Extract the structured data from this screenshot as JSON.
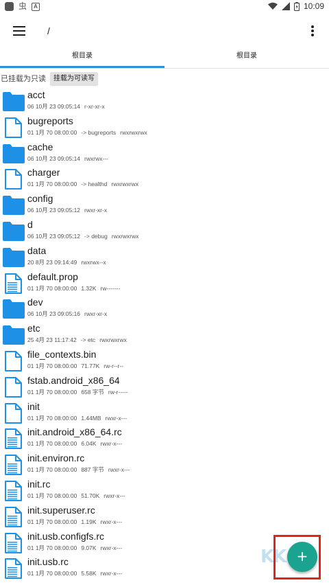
{
  "status_bar": {
    "left_glyph": "虫",
    "a_glyph": "A",
    "time": "10:09"
  },
  "toolbar": {
    "path": "/"
  },
  "tabs": [
    {
      "label": "根目录",
      "active": true
    },
    {
      "label": "根目录",
      "active": false
    }
  ],
  "mount": {
    "label": "已挂载为只读",
    "button": "挂载为可读写"
  },
  "files": [
    {
      "name": "acct",
      "type": "folder",
      "date": "06 10月 23 09:05:14",
      "extra": "",
      "perm": "r-xr-xr-x"
    },
    {
      "name": "bugreports",
      "type": "file",
      "date": "01 1月 70 08:00:00",
      "extra": "-> bugreports",
      "perm": "rwxrwxrwx"
    },
    {
      "name": "cache",
      "type": "folder",
      "date": "06 10月 23 09:05:14",
      "extra": "",
      "perm": "rwxrwx---"
    },
    {
      "name": "charger",
      "type": "file",
      "date": "01 1月 70 08:00:00",
      "extra": "-> healthd",
      "perm": "rwxrwxrwx"
    },
    {
      "name": "config",
      "type": "folder",
      "date": "06 10月 23 09:05:12",
      "extra": "",
      "perm": "rwxr-xr-x"
    },
    {
      "name": "d",
      "type": "folder",
      "date": "06 10月 23 09:05:12",
      "extra": "-> debug",
      "perm": "rwxrwxrwx"
    },
    {
      "name": "data",
      "type": "folder",
      "date": "20 8月 23 09:14:49",
      "extra": "",
      "perm": "rwxrwx--x"
    },
    {
      "name": "default.prop",
      "type": "doc",
      "date": "01 1月 70 08:00:00",
      "extra": "1.32K",
      "perm": "rw-------"
    },
    {
      "name": "dev",
      "type": "folder",
      "date": "06 10月 23 09:05:16",
      "extra": "",
      "perm": "rwxr-xr-x"
    },
    {
      "name": "etc",
      "type": "folder",
      "date": "25 4月 23 11:17:42",
      "extra": "-> etc",
      "perm": "rwxrwxrwx"
    },
    {
      "name": "file_contexts.bin",
      "type": "file",
      "date": "01 1月 70 08:00:00",
      "extra": "71.77K",
      "perm": "rw-r--r--"
    },
    {
      "name": "fstab.android_x86_64",
      "type": "file",
      "date": "01 1月 70 08:00:00",
      "extra": "658 字节",
      "perm": "rw-r-----"
    },
    {
      "name": "init",
      "type": "file",
      "date": "01 1月 70 08:00:00",
      "extra": "1.44MB",
      "perm": "rwxr-x---"
    },
    {
      "name": "init.android_x86_64.rc",
      "type": "doc",
      "date": "01 1月 70 08:00:00",
      "extra": "6.04K",
      "perm": "rwxr-x---"
    },
    {
      "name": "init.environ.rc",
      "type": "doc",
      "date": "01 1月 70 08:00:00",
      "extra": "887 字节",
      "perm": "rwxr-x---"
    },
    {
      "name": "init.rc",
      "type": "doc",
      "date": "01 1月 70 08:00:00",
      "extra": "51.70K",
      "perm": "rwxr-x---"
    },
    {
      "name": "init.superuser.rc",
      "type": "doc",
      "date": "01 1月 70 08:00:00",
      "extra": "1.19K",
      "perm": "rwxr-x---"
    },
    {
      "name": "init.usb.configfs.rc",
      "type": "doc",
      "date": "01 1月 70 08:00:00",
      "extra": "9.07K",
      "perm": "rwxr-x---"
    },
    {
      "name": "init.usb.rc",
      "type": "doc",
      "date": "01 1月 70 08:00:00",
      "extra": "5.58K",
      "perm": "rwxr-x---"
    }
  ],
  "fab": {
    "label": "+"
  },
  "watermark": "KK下载",
  "colors": {
    "folder": "#1e90e6",
    "accent": "#2f92d5",
    "fab": "#1aa38f",
    "highlight": "#e2231a"
  }
}
